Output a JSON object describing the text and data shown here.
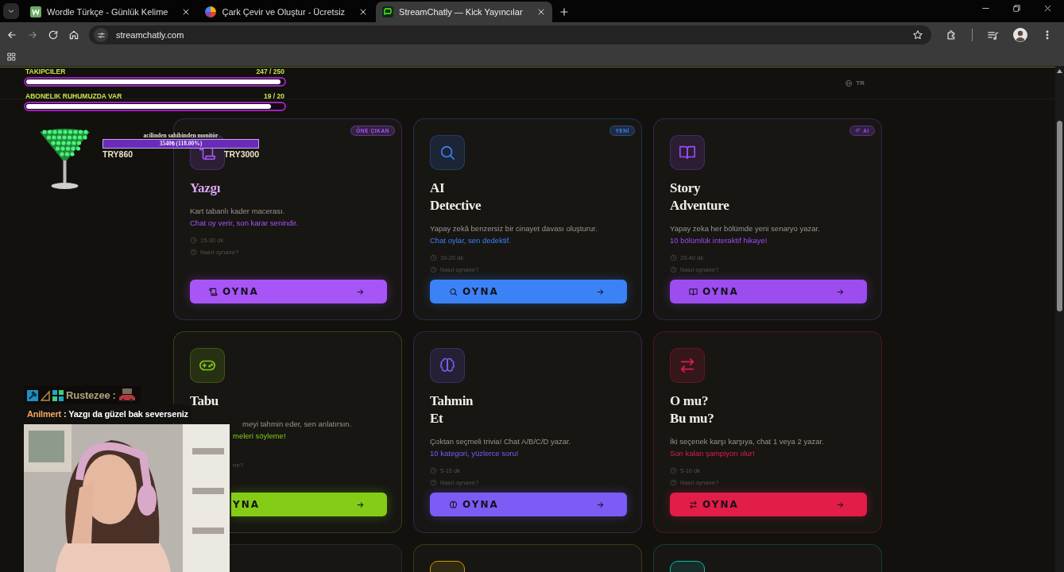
{
  "browser": {
    "tabs": [
      {
        "title": "Wordle Türkçe - Günlük Kelime",
        "selected": false
      },
      {
        "title": "Çark Çevir ve Oluştur - Ücretsiz",
        "selected": false
      },
      {
        "title": "StreamChatly — Kick Yayıncılar",
        "selected": true
      }
    ],
    "address": "streamchatly.com"
  },
  "page": {
    "language": "TR",
    "cards": [
      {
        "kind": "game",
        "color": "#a855f7",
        "badge": {
          "kind": "plain",
          "text": "ÖNE ÇIKAN"
        },
        "title": "Yazgı",
        "description": "Kart tabanlı kader macerası.",
        "highlight": "Chat oy verir, son karar senindir.",
        "duration": "15-30 dk",
        "help": "Nasıl oynanır?",
        "button": "OYNA"
      },
      {
        "kind": "game",
        "color": "#3b82f6",
        "badge": {
          "kind": "plain",
          "text": "YENİ"
        },
        "title": "AI\nDetective",
        "description": "Yapay zekâ benzersiz bir cinayet davası oluşturur.",
        "highlight": "Chat oylar, sen dedektif.",
        "duration": "10-20 dk",
        "help": "Nasıl oynanır?",
        "button": "OYNA"
      },
      {
        "kind": "game",
        "color": "#9d4cf0",
        "badge": {
          "kind": "ai",
          "text": "AI"
        },
        "title": "Story\nAdventure",
        "description": "Yapay zeka her bölümde yeni senaryo yazar.",
        "highlight": "10 bölümlük interaktif hikaye!",
        "duration": "20-40 dk",
        "help": "Nasıl oynanır?",
        "button": "OYNA"
      },
      {
        "kind": "game",
        "color": "#84cc16",
        "title": "Tabu",
        "description": "meyi tahmin eder, sen anlatırsın.",
        "highlight": "meleri söyleme!",
        "help": "nır?",
        "button": "YNA"
      },
      {
        "kind": "game",
        "color": "#7c5cf5",
        "title": "Tahmin\nEt",
        "description": "Çoktan seçmeli trivia! Chat A/B/C/D yazar.",
        "highlight": "10 kategori, yüzlerce soru!",
        "duration": "5-15 dk",
        "help": "Nasıl oynanır?",
        "button": "OYNA"
      },
      {
        "kind": "game",
        "color": "#e11d48",
        "title": "O mu?\nBu mu?",
        "description": "İki seçenek karşı karşıya, chat 1 veya 2 yazar.",
        "highlight": "Son kalan şampiyon olur!",
        "duration": "5-10 dk",
        "help": "Nasıl oynanır?",
        "button": "OYNA"
      },
      {
        "kind": "stub"
      },
      {
        "kind": "stub",
        "color": "#ca9a04"
      },
      {
        "kind": "stub",
        "color": "#14b8a6"
      }
    ]
  },
  "overlay": {
    "goals": [
      {
        "label": "TAKIPCILER",
        "count": "247 / 250",
        "level": 0.988
      },
      {
        "label": "ABONELIK RUHUMUZDA VAR",
        "count": "19 / 20",
        "level": 0.95
      }
    ],
    "donation_goal": {
      "title": "acilinden sahibinden monitör",
      "amount": "3540₺ (118.00%)",
      "level": 1,
      "start": "TRY860",
      "target": "TRY3000"
    },
    "chat": [
      {
        "user": "Rustezee",
        "color": "#b3a27a",
        "text": ":"
      },
      {
        "user": "Anilmert",
        "color": "#f5a65b",
        "text": ": Yazgı da güzel bak severseniz"
      }
    ]
  }
}
